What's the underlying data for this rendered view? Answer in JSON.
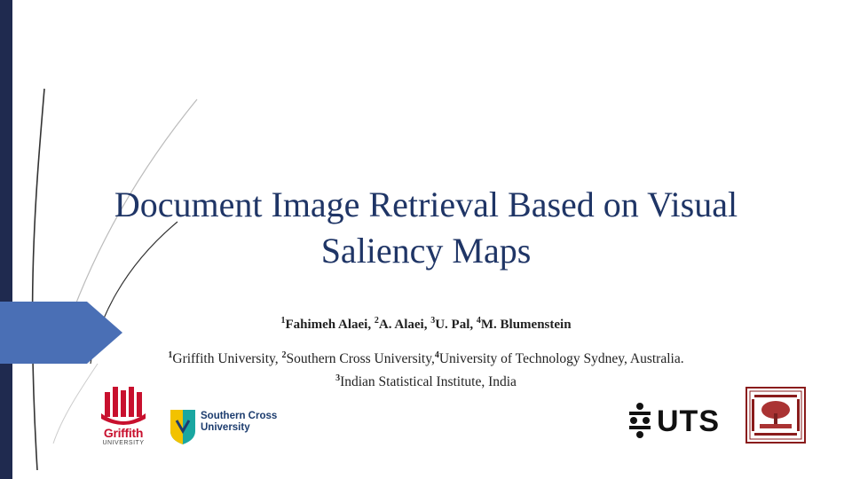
{
  "slide": {
    "title": "Document Image Retrieval Based on Visual Saliency Maps",
    "authors": [
      {
        "sup": "1",
        "name": "Fahimeh Alaei, "
      },
      {
        "sup": "2",
        "name": "A. Alaei, "
      },
      {
        "sup": "3",
        "name": "U. Pal, "
      },
      {
        "sup": "4",
        "name": "M. Blumenstein"
      }
    ],
    "affiliations_line1": [
      {
        "sup": "1",
        "name": "Griffith University, "
      },
      {
        "sup": "2",
        "name": "Southern Cross University,"
      },
      {
        "sup": "4",
        "name": "University of Technology Sydney, Australia."
      }
    ],
    "affiliations_line2": {
      "sup": "3",
      "name": "Indian Statistical Institute, India"
    }
  },
  "logos": {
    "griffith": {
      "name": "Griffith",
      "sub": "UNIVERSITY"
    },
    "scu": {
      "line1": "Southern Cross",
      "line2": "University"
    },
    "uts": {
      "text": "UTS"
    }
  },
  "colors": {
    "accent_bar": "#1f2a4f",
    "accent_shape": "#4a6fb5",
    "title": "#1f3566",
    "griffith_red": "#c8102e"
  }
}
